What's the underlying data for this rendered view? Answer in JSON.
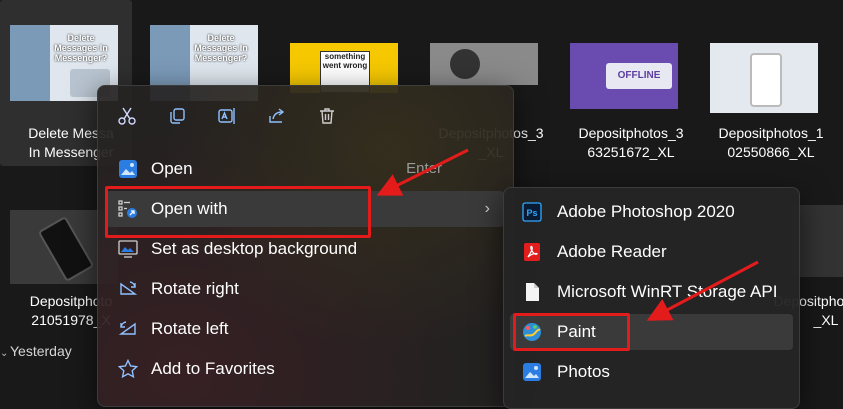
{
  "files": [
    {
      "label": "Delete Messa\nIn Messenger",
      "thumb_text": "Delete Messages In Messenger?"
    },
    {
      "label": "",
      "thumb_text": "Delete Messages In Messenger?"
    },
    {
      "label": "",
      "thumb_text": "something went wrong"
    },
    {
      "label": "Depositphotos_3\n_XL",
      "thumb_text": ""
    },
    {
      "label": "Depositphotos_3\n63251672_XL",
      "thumb_text": "OFFLINE"
    },
    {
      "label": "Depositphotos_1\n02550866_XL",
      "thumb_text": ""
    },
    {
      "label": "Depositphoto\n21051978_X",
      "thumb_text": ""
    },
    {
      "label": "Depositphotos_1\n_XL",
      "thumb_text": ""
    }
  ],
  "group_header": "Yesterday",
  "quick_actions": [
    "cut",
    "copy",
    "rename",
    "share",
    "delete"
  ],
  "menu": {
    "items": [
      {
        "label": "Open",
        "accelerator": "Enter",
        "icon": "photos-icon"
      },
      {
        "label": "Open with",
        "submenu_arrow": "›",
        "icon": "open-with-icon"
      },
      {
        "label": "Set as desktop background",
        "icon": "wallpaper-icon"
      },
      {
        "label": "Rotate right",
        "icon": "rotate-right-icon"
      },
      {
        "label": "Rotate left",
        "icon": "rotate-left-icon"
      },
      {
        "label": "Add to Favorites",
        "icon": "star-icon"
      }
    ]
  },
  "submenu": {
    "items": [
      {
        "label": "Adobe Photoshop 2020",
        "icon": "photoshop-icon"
      },
      {
        "label": "Adobe Reader",
        "icon": "adobe-reader-icon"
      },
      {
        "label": "Microsoft WinRT Storage API",
        "icon": "file-icon"
      },
      {
        "label": "Paint",
        "icon": "paint-icon"
      },
      {
        "label": "Photos",
        "icon": "photos-icon"
      }
    ]
  },
  "colors": {
    "highlight_box": "#e41b1b",
    "background": "#191919"
  }
}
